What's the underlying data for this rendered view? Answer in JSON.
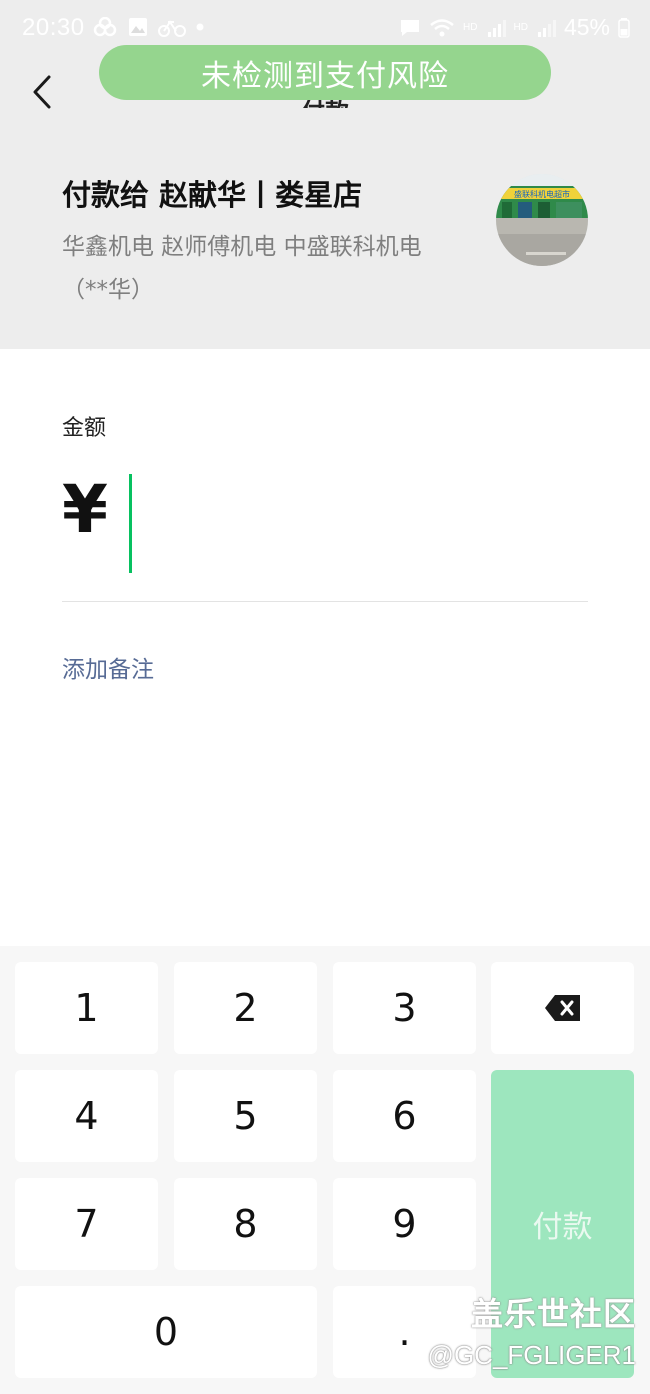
{
  "status_bar": {
    "time": "20:30",
    "network_label_1": "HD",
    "network_label_2": "HD",
    "battery": "45%"
  },
  "banner": {
    "text": "未检测到支付风险"
  },
  "header": {
    "title": "付款"
  },
  "payee": {
    "title": "付款给 赵献华丨娄星店",
    "description": "华鑫机电 赵师傅机电 中盛联科机电（**华）",
    "avatar_sign_text": "盛联科机电超市"
  },
  "amount": {
    "label": "金额",
    "currency_symbol": "¥",
    "value": ""
  },
  "note": {
    "link_label": "添加备注"
  },
  "keypad": {
    "keys": [
      "1",
      "2",
      "3",
      "4",
      "5",
      "6",
      "7",
      "8",
      "9",
      "0",
      "."
    ],
    "delete_icon": "backspace-icon",
    "pay_label": "付款"
  },
  "watermark": {
    "brand": "盖乐世社区",
    "user": "@GC_FGLIGER1"
  },
  "colors": {
    "banner": "#95d58e",
    "caret": "#07c160",
    "link": "#576b95",
    "pay_button": "#9de6be",
    "top_background": "#ededed"
  }
}
